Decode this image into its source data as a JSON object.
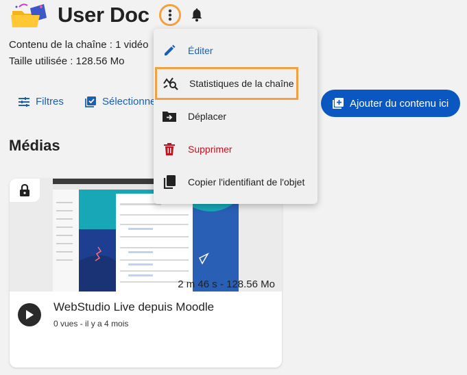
{
  "header": {
    "title": "User Doc"
  },
  "channel_info": {
    "content_line": "Contenu de la chaîne : 1 vidéo",
    "size_line": "Taille utilisée : 128.56 Mo"
  },
  "toolbar": {
    "filters_label": "Filtres",
    "select_label": "Sélectionner",
    "add_content_label": "Ajouter du contenu ici"
  },
  "section": {
    "title": "Médias"
  },
  "media": [
    {
      "title": "WebStudio Live depuis Moodle",
      "duration_size": "2 m 46 s - 128.56 Mo",
      "views": "0 vues",
      "age": "il y a 4 mois"
    }
  ],
  "menu": {
    "items": [
      {
        "label": "Éditer",
        "color": "#1a5fb4"
      },
      {
        "label": "Statistiques de la chaîne",
        "color": "#1f1f1f"
      },
      {
        "label": "Déplacer",
        "color": "#1f1f1f"
      },
      {
        "label": "Supprimer",
        "color": "#c1121f"
      },
      {
        "label": "Copier l'identifiant de l'objet",
        "color": "#1f1f1f"
      }
    ]
  },
  "colors": {
    "primary": "#0b57c2",
    "highlight": "#f5a040",
    "danger": "#c1121f"
  }
}
